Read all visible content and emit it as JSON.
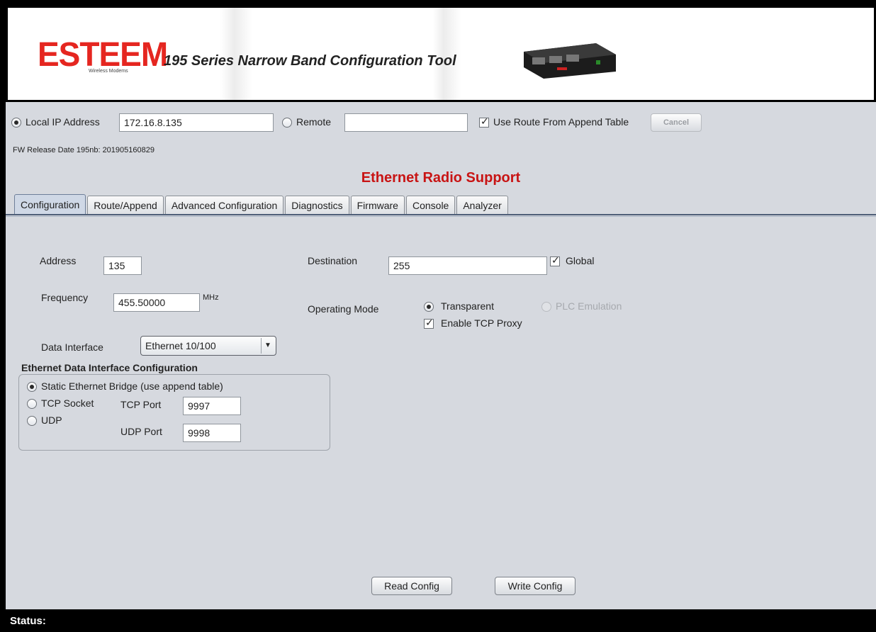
{
  "header": {
    "logo_text": "ESTEEM",
    "logo_subtext": "Wireless Modems",
    "title": "195 Series Narrow Band Configuration Tool"
  },
  "connection": {
    "local_label": "Local IP Address",
    "local_ip": "172.16.8.135",
    "local_selected": true,
    "remote_label": "Remote",
    "remote_value": "",
    "remote_selected": false,
    "use_route_label": "Use Route From Append Table",
    "use_route_checked": true,
    "cancel_label": "Cancel"
  },
  "fw_release": "FW Release Date 195nb: 201905160829",
  "section_title": "Ethernet Radio Support",
  "tabs": [
    {
      "label": "Configuration",
      "active": true
    },
    {
      "label": "Route/Append",
      "active": false
    },
    {
      "label": "Advanced Configuration",
      "active": false
    },
    {
      "label": "Diagnostics",
      "active": false
    },
    {
      "label": "Firmware",
      "active": false
    },
    {
      "label": "Console",
      "active": false
    },
    {
      "label": "Analyzer",
      "active": false
    }
  ],
  "config": {
    "address_label": "Address",
    "address_value": "135",
    "frequency_label": "Frequency",
    "frequency_value": "455.50000",
    "frequency_unit": "MHz",
    "destination_label": "Destination",
    "destination_value": "255",
    "global_label": "Global",
    "global_checked": true,
    "operating_mode_label": "Operating Mode",
    "transparent_label": "Transparent",
    "transparent_selected": true,
    "plc_label": "PLC Emulation",
    "plc_enabled": false,
    "tcp_proxy_label": "Enable TCP Proxy",
    "tcp_proxy_checked": true,
    "data_interface_label": "Data Interface",
    "data_interface_value": "Ethernet 10/100"
  },
  "eth_group": {
    "title": "Ethernet Data Interface Configuration",
    "static_label": "Static Ethernet Bridge (use append table)",
    "static_selected": true,
    "tcp_socket_label": "TCP Socket",
    "udp_label": "UDP",
    "tcp_port_label": "TCP Port",
    "tcp_port_value": "9997",
    "udp_port_label": "UDP Port",
    "udp_port_value": "9998"
  },
  "actions": {
    "read_label": "Read Config",
    "write_label": "Write Config"
  },
  "status": {
    "label": "Status:"
  },
  "colors": {
    "accent_red": "#c81414",
    "logo_red": "#e52620",
    "panel_bg": "#d6d9df"
  }
}
